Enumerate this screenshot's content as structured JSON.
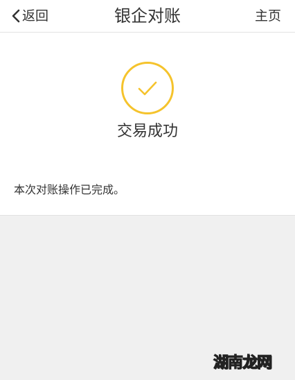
{
  "header": {
    "back_label": "返回",
    "title": "银企对账",
    "home_label": "主页"
  },
  "result": {
    "status_text": "交易成功",
    "message": "本次对账操作已完成。"
  },
  "watermark": {
    "part1": "湖",
    "part2": "南",
    "part3": "龙网"
  },
  "colors": {
    "accent": "#f5c32c",
    "text": "#333333",
    "background_gray": "#f0f0f0"
  },
  "icons": {
    "back": "chevron-left-icon",
    "success": "checkmark-circle-icon"
  }
}
